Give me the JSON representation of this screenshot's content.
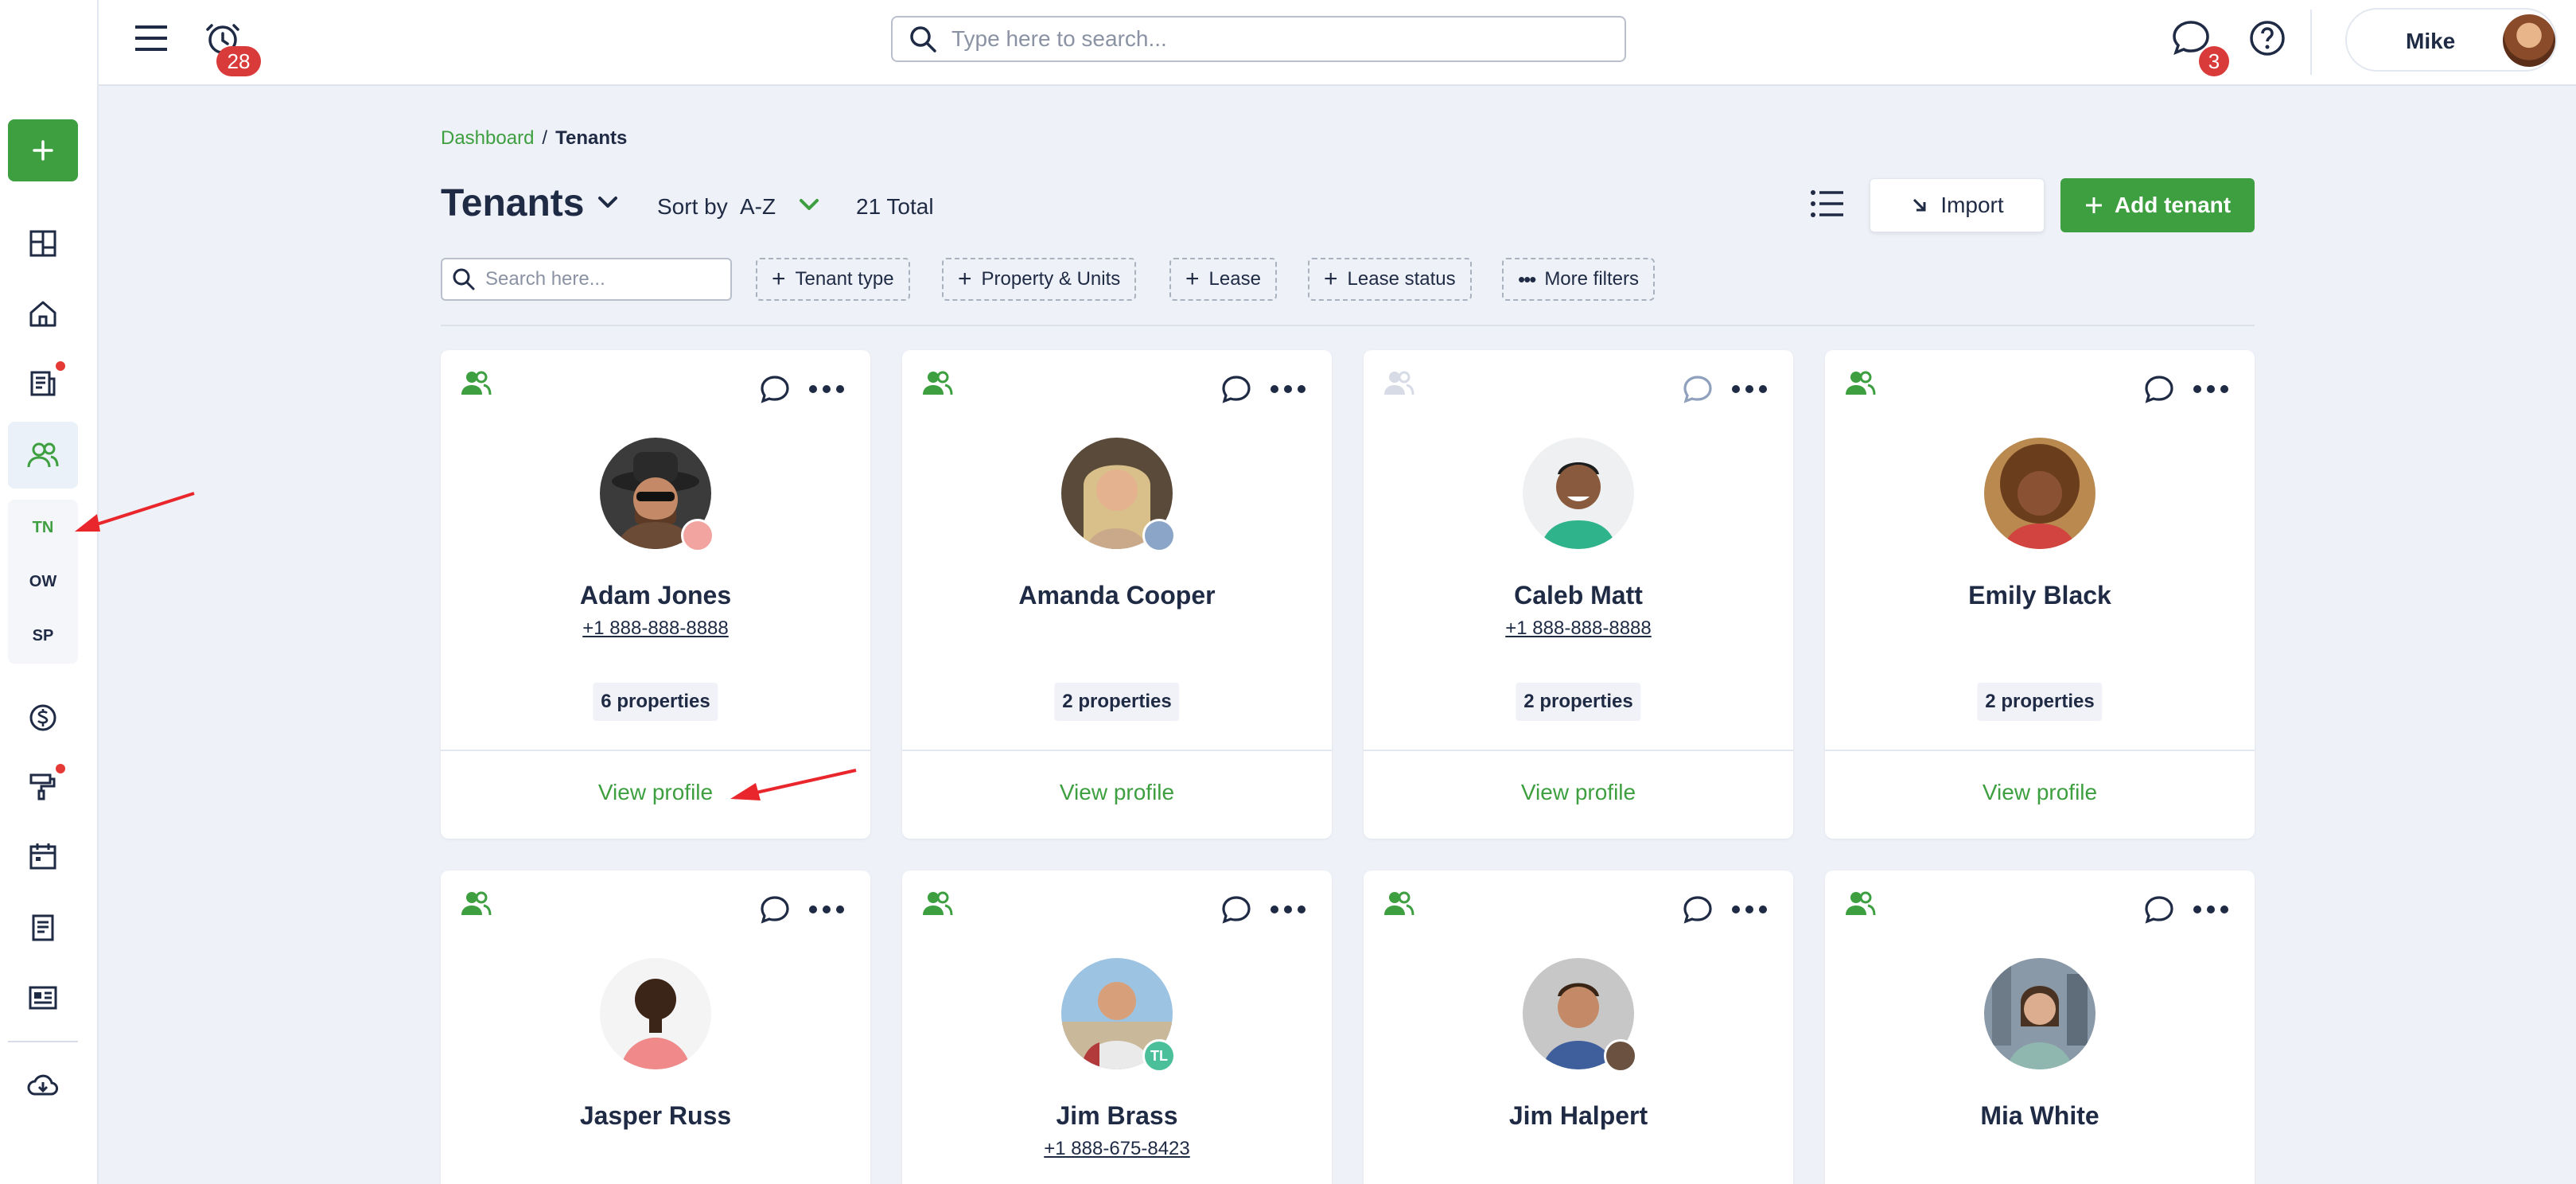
{
  "topbar": {
    "alarm_count": "28",
    "search_placeholder": "Type here to search...",
    "chat_count": "3",
    "user_name": "Mike"
  },
  "sidebar": {
    "sub_items": [
      {
        "label": "TN",
        "active": true
      },
      {
        "label": "OW",
        "active": false
      },
      {
        "label": "SP",
        "active": false
      }
    ]
  },
  "breadcrumb": {
    "items": [
      "Dashboard",
      "Tenants"
    ],
    "separator": "/"
  },
  "header": {
    "title": "Tenants",
    "sort_label": "Sort by",
    "sort_value": "A-Z",
    "total": "21 Total",
    "import_label": "Import",
    "add_label": "Add tenant"
  },
  "filters": {
    "search_placeholder": "Search here...",
    "chips": [
      "Tenant type",
      "Property & Units",
      "Lease",
      "Lease status",
      "More filters"
    ]
  },
  "tenants": [
    {
      "name": "Adam Jones",
      "phone": "+1 888-888-8888",
      "properties": "6 properties",
      "view": "View profile",
      "active": true
    },
    {
      "name": "Amanda Cooper",
      "phone": "",
      "properties": "2 properties",
      "view": "View profile",
      "active": true
    },
    {
      "name": "Caleb Matt",
      "phone": "+1 888-888-8888",
      "properties": "2 properties",
      "view": "View profile",
      "active": false
    },
    {
      "name": "Emily Black",
      "phone": "",
      "properties": "2 properties",
      "view": "View profile",
      "active": true
    },
    {
      "name": "Jasper Russ",
      "phone": "",
      "active": true
    },
    {
      "name": "Jim Brass",
      "phone": "+1 888-675-8423",
      "mini_initials": "TL",
      "active": true
    },
    {
      "name": "Jim Halpert",
      "phone": "",
      "active": true
    },
    {
      "name": "Mia White",
      "phone": "",
      "active": true
    }
  ],
  "colors": {
    "accent": "#3d9f3f",
    "badge": "#d93a3a",
    "annotation": "#e8262b"
  }
}
